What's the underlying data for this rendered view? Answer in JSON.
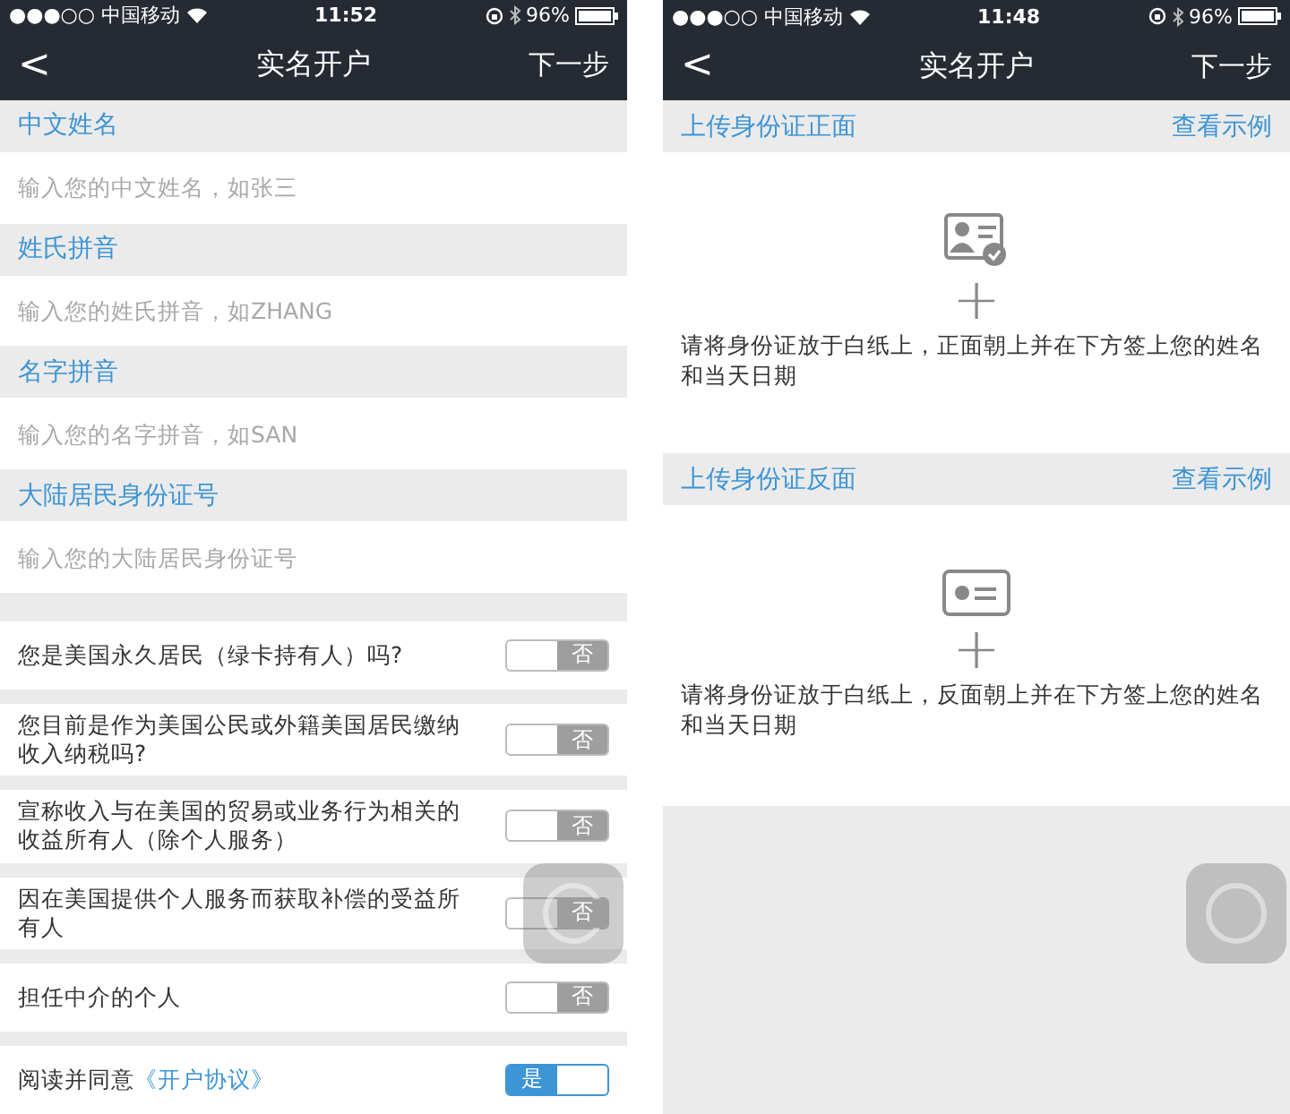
{
  "left_screen": {
    "status_bar": {
      "carrier": "●●●○○ 中国移动",
      "time": "11:52",
      "battery": "96%"
    },
    "nav_bar": {
      "back": "<",
      "title": "实名开户",
      "next": "下一步"
    },
    "fields": [
      {
        "label": "中文姓名",
        "placeholder": "输入您的中文姓名，如张三"
      },
      {
        "label": "姓氏拼音",
        "placeholder": "输入您的姓氏拼音，如ZHANG"
      },
      {
        "label": "名字拼音",
        "placeholder": "输入您的名字拼音，如SAN"
      },
      {
        "label": "大陆居民身份证号",
        "placeholder": "输入您的大陆居民身份证号"
      }
    ],
    "questions": [
      {
        "text": "您是美国永久居民（绿卡持有人）吗?",
        "on": false,
        "toggle_label": "否"
      },
      {
        "text": "您目前是作为美国公民或外籍美国居民缴纳收入纳税吗?",
        "on": false,
        "toggle_label": "否"
      },
      {
        "text": "宣称收入与在美国的贸易或业务行为相关的收益所有人（除个人服务）",
        "on": false,
        "toggle_label": "否"
      },
      {
        "text": "因在美国提供个人服务而获取补偿的受益所有人",
        "on": false,
        "toggle_label": "否"
      },
      {
        "text": "担任中介的个人",
        "on": false,
        "toggle_label": "否"
      }
    ],
    "agreement": {
      "text": "阅读并同意",
      "link": "《开户协议》",
      "on": true,
      "toggle_label": "是"
    }
  },
  "right_screen": {
    "status_bar": {
      "carrier": "●●●○○ 中国移动",
      "time": "11:48",
      "battery": "96%"
    },
    "nav_bar": {
      "back": "<",
      "title": "实名开户",
      "next": "下一步"
    },
    "uploads": [
      {
        "kind": "front",
        "title": "上传身份证正面",
        "link": "查看示例",
        "plus": "+",
        "instruction": "请将身份证放于白纸上，正面朝上并在下方签上您的姓名和当天日期"
      },
      {
        "kind": "back",
        "title": "上传身份证反面",
        "link": "查看示例",
        "plus": "+",
        "instruction": "请将身份证放于白纸上，反面朝上并在下方签上您的姓名和当天日期"
      }
    ]
  }
}
